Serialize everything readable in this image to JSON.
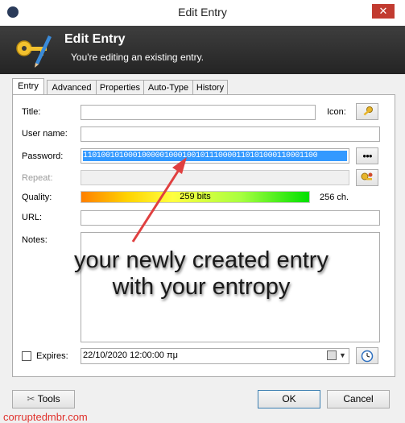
{
  "window": {
    "title": "Edit Entry",
    "close_glyph": "✕"
  },
  "banner": {
    "title": "Edit Entry",
    "subtitle": "You're editing an existing entry."
  },
  "tabs": [
    {
      "label": "Entry",
      "active": true
    },
    {
      "label": "Advanced",
      "active": false
    },
    {
      "label": "Properties",
      "active": false
    },
    {
      "label": "Auto-Type",
      "active": false
    },
    {
      "label": "History",
      "active": false
    }
  ],
  "form": {
    "title_label": "Title:",
    "title_value": "",
    "icon_label": "Icon:",
    "username_label": "User name:",
    "username_value": "",
    "password_label": "Password:",
    "password_value": "1101001010001000001000100101110000110101000110001100",
    "reveal_label": "●●●",
    "repeat_label": "Repeat:",
    "quality_label": "Quality:",
    "quality_text": "259 bits",
    "quality_fraction": 1.0,
    "chars_text": "256 ch.",
    "url_label": "URL:",
    "url_value": "",
    "notes_label": "Notes:",
    "expires_label": "Expires:",
    "expires_value": "22/10/2020 12:00:00 πμ",
    "expires_checked": false
  },
  "buttons": {
    "tools": "Tools",
    "ok": "OK",
    "cancel": "Cancel"
  },
  "annotation": {
    "line1": "your newly created entry",
    "line2": "with your entropy",
    "color": "#e04040"
  },
  "watermark": "corruptedmbr.com",
  "colors": {
    "selection": "#3399ff",
    "banner": "#2e2e2e",
    "close": "#c23b30"
  },
  "icons": {
    "window": "lock-icon",
    "banner": "key-pen-icon",
    "title_icon": "key-icon",
    "generator": "key-gear-icon",
    "calendar": "clock-icon",
    "tools": "wrench-icon"
  }
}
